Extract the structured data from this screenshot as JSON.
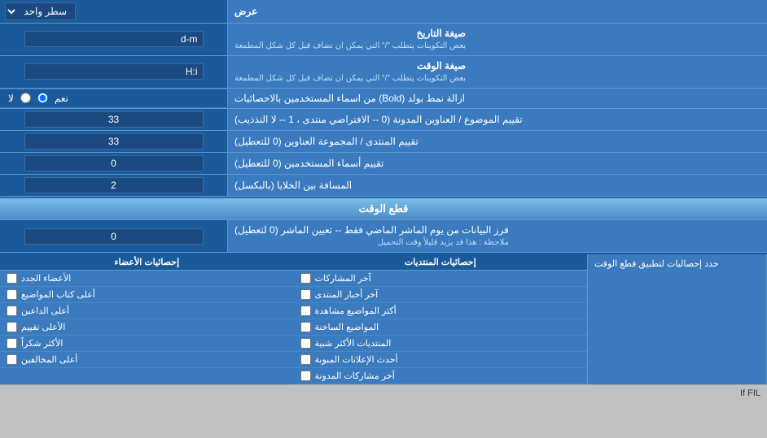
{
  "page": {
    "title": "عرض",
    "select_options": [
      "سطر واحد"
    ],
    "selected_option": "سطر واحد",
    "rows": [
      {
        "id": "date_format",
        "label": "صيغة التاريخ",
        "sublabel": "بعض التكوينات يتطلب \"/\" التي يمكن ان تضاف قبل كل شكل المطمعة",
        "value": "d-m",
        "type": "text"
      },
      {
        "id": "time_format",
        "label": "صيغة الوقت",
        "sublabel": "بعض التكوينات يتطلب \"/\" التي يمكن ان تضاف قبل كل شكل المطمعة",
        "value": "H:i",
        "type": "text"
      },
      {
        "id": "remove_bold",
        "label": "ازالة نمط بولد (Bold) من اسماء المستخدمين بالاحصائيات",
        "type": "radio",
        "options": [
          "نعم",
          "لا"
        ],
        "selected": "نعم"
      },
      {
        "id": "topics_order",
        "label": "تقييم الموضوع / العناوين المدونة (0 -- الافتراضي منتدى ، 1 -- لا التذذيب)",
        "value": "33",
        "type": "text"
      },
      {
        "id": "forum_order",
        "label": "تقييم المنتدى / المجموعة العناوين (0 للتعطيل)",
        "value": "33",
        "type": "text"
      },
      {
        "id": "users_order",
        "label": "تقييم أسماء المستخدمين (0 للتعطيل)",
        "value": "0",
        "type": "text"
      },
      {
        "id": "entry_distance",
        "label": "المسافة بين الخلايا (بالبكسل)",
        "value": "2",
        "type": "text"
      }
    ],
    "cutoff_section": {
      "title": "قطع الوقت",
      "row": {
        "label": "فرز البيانات من يوم الماشر الماضي فقط -- تعيين الماشر (0 لتعطيل)",
        "note": "ملاحظة : هذا قد يزيد قليلاً وقت التحميل",
        "value": "0"
      },
      "apply_label": "حدد إحصاليات لتطبيق قطع الوقت"
    },
    "stats": {
      "col1": {
        "header": "إحصائيات الأعضاء",
        "items": [
          "الأعضاء الجدد",
          "أعلى كتاب المواضيع",
          "أعلى الداعين",
          "الأعلى تقييم",
          "الأكثر شكراً",
          "أعلى المخالفين"
        ]
      },
      "col2": {
        "header": "إحصائيات المنتديات",
        "items": [
          "آخر المشاركات",
          "آخر أخبار المنتدى",
          "أكثر المواضيع مشاهدة",
          "المواضيع الساخنة",
          "المنتديات الأكثر شبية",
          "أحدث الإعلانات المبوبة",
          "آخر مشاركات المدونة"
        ]
      },
      "col3_label": "حدد إحصاليات لتطبيق قطع الوقت"
    }
  }
}
